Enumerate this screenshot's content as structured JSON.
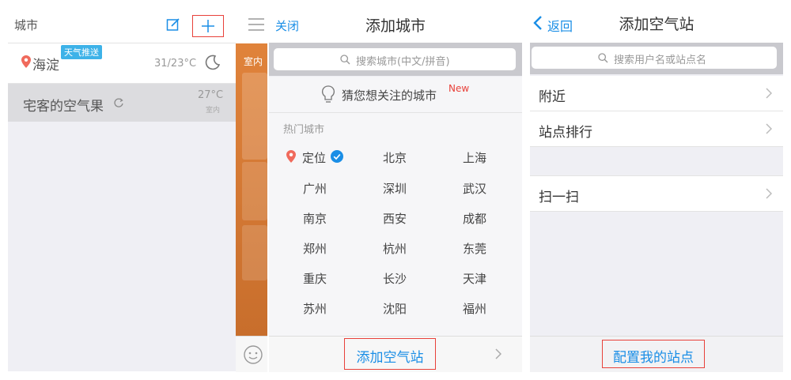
{
  "panel1": {
    "title": "城市",
    "city1": {
      "name": "海淀",
      "badge": "天气推送",
      "temp": "31/23°C"
    },
    "city2": {
      "name": "宅客的空气果",
      "temp": "27°C",
      "sub": "室内"
    }
  },
  "panel2": {
    "label": "室内"
  },
  "panel3": {
    "close": "关闭",
    "title": "添加城市",
    "search_placeholder": "搜索城市(中文/拼音)",
    "guess": "猜您想关注的城市",
    "new_tag": "New",
    "section": "热门城市",
    "locate": "定位",
    "cities": [
      "北京",
      "上海",
      "广州",
      "深圳",
      "武汉",
      "南京",
      "西安",
      "成都",
      "郑州",
      "杭州",
      "东莞",
      "重庆",
      "长沙",
      "天津",
      "苏州",
      "沈阳",
      "福州"
    ],
    "footer": "添加空气站"
  },
  "panel4": {
    "back": "返回",
    "title": "添加空气站",
    "search_placeholder": "搜索用户名或站点名",
    "items": [
      "附近",
      "站点排行",
      "扫一扫"
    ],
    "footer": "配置我的站点"
  },
  "colors": {
    "accent": "#1a8ee6",
    "highlight": "#e8413a",
    "orange": "#e0833b"
  }
}
